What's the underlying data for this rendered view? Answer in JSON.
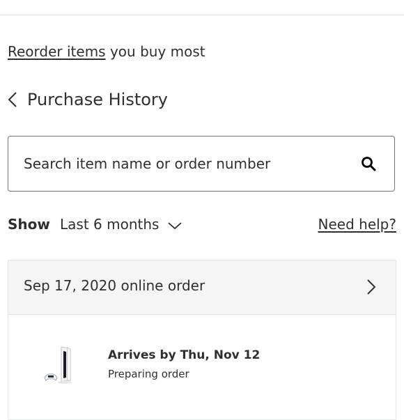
{
  "reorder": {
    "link_text": "Reorder items",
    "suffix": " you buy most"
  },
  "history": {
    "back_icon": "chevron-left-icon",
    "title": "Purchase History"
  },
  "search": {
    "placeholder": "Search item name or order number",
    "value": "",
    "icon": "search-icon"
  },
  "filter": {
    "show_label": "Show",
    "selected_range": "Last 6 months",
    "dropdown_icon": "chevron-down-icon",
    "help_link": "Need help?"
  },
  "orders": [
    {
      "header": "Sep 17, 2020 online order",
      "chevron_icon": "chevron-right-icon",
      "items": [
        {
          "arrival": "Arrives by Thu, Nov 12",
          "status": "Preparing order",
          "thumbnail": "game-console-image"
        }
      ]
    }
  ]
}
